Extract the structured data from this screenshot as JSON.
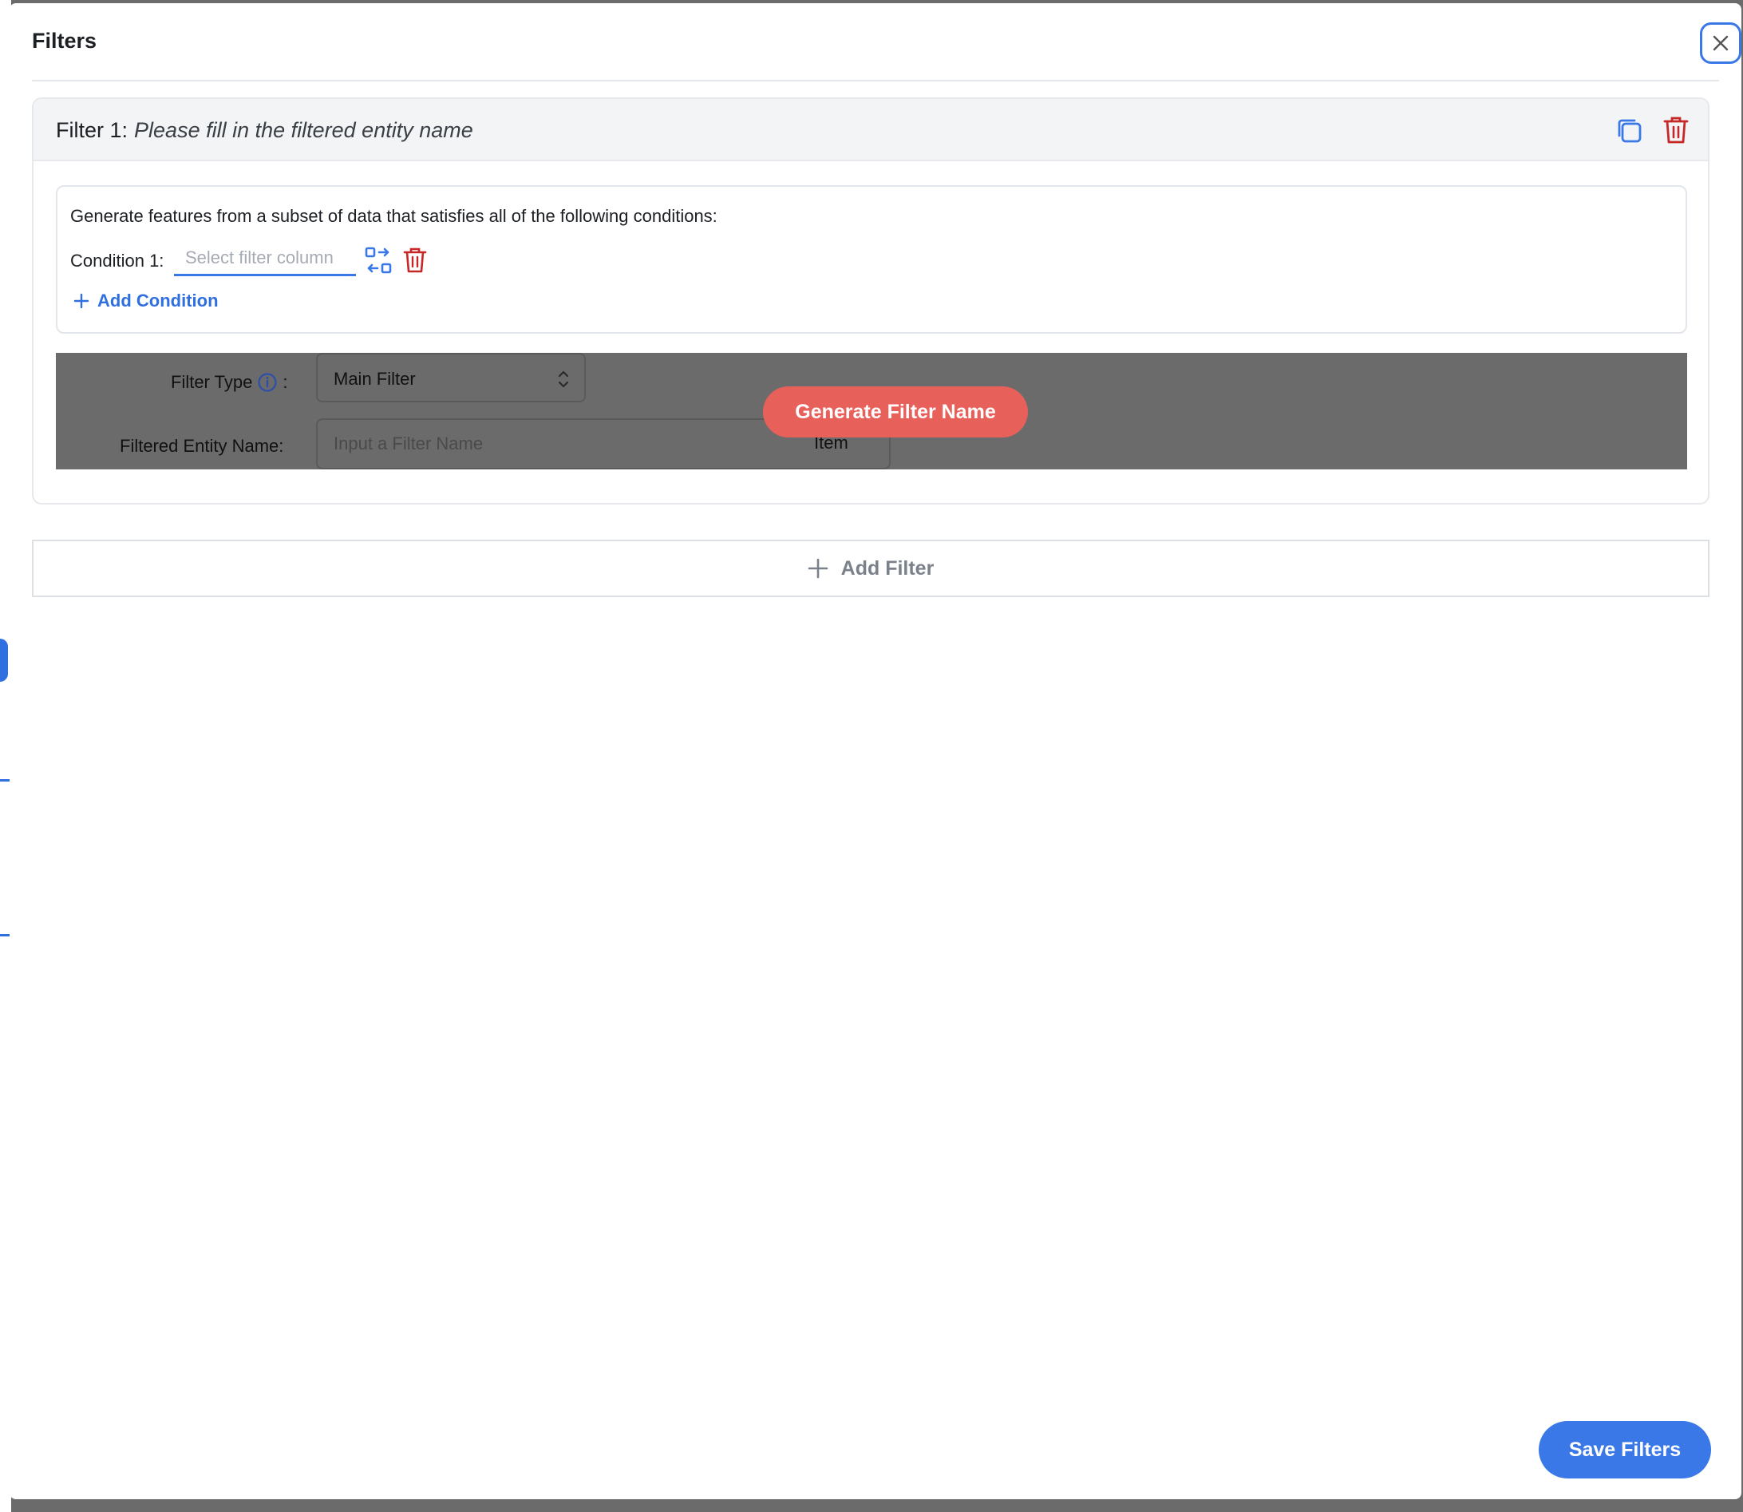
{
  "modal": {
    "title": "Filters",
    "close_icon": "close-icon"
  },
  "filter": {
    "label": "Filter 1:",
    "hint": "Please fill in the filtered entity name",
    "copy_icon": "copy-icon",
    "trash_icon": "trash-icon",
    "conditions_description": "Generate features from a subset of data that satisfies all of the following conditions:",
    "condition_label": "Condition 1:",
    "condition_placeholder": "Select filter column",
    "add_condition_label": "Add Condition",
    "filter_type_label": "Filter Type",
    "filter_type_colon": ":",
    "filter_type_value": "Main Filter",
    "filtered_entity_label": "Filtered Entity Name:",
    "filtered_entity_placeholder": "Input a Filter Name",
    "filtered_entity_suffix": "Item",
    "generate_button_label": "Generate Filter Name"
  },
  "add_filter_label": "Add Filter",
  "save_button_label": "Save Filters",
  "colors": {
    "accent": "#3b78e7",
    "danger": "#c62828",
    "generate": "#e8605a"
  }
}
